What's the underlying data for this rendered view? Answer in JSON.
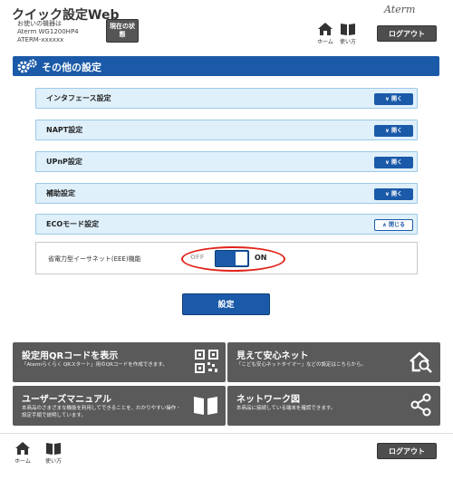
{
  "header": {
    "app_title": "クイック設定Web",
    "model_label": "お使いの機器は",
    "model_name": "Aterm WG1200HP4",
    "model_ssid": "ATERM-xxxxxx",
    "status_button": "現在の状態",
    "nav": {
      "home_label": "ホーム",
      "guide_label": "使い方"
    },
    "brand": "Aterm",
    "logout_label": "ログアウト"
  },
  "section": {
    "title": "その他の設定"
  },
  "accordion": [
    {
      "label": "インタフェース設定",
      "button": "開く",
      "expanded": false
    },
    {
      "label": "NAPT設定",
      "button": "開く",
      "expanded": false
    },
    {
      "label": "UPnP設定",
      "button": "開く",
      "expanded": false
    },
    {
      "label": "補助設定",
      "button": "開く",
      "expanded": false
    },
    {
      "label": "ECOモード設定",
      "button": "閉じる",
      "expanded": true
    }
  ],
  "eco": {
    "setting_label": "省電力型イーサネット(EEE)機能",
    "toggle_off": "OFF",
    "toggle_on": "ON",
    "state": "ON"
  },
  "submit_label": "設定",
  "tiles": [
    {
      "title": "設定用QRコードを表示",
      "desc": "「Atermらくらく QRスタート」用のQRコードを作成できます。",
      "icon": "qr-code-icon"
    },
    {
      "title": "見えて安心ネット",
      "desc": "「こども安心ネットタイマー」などの設定はこちらから。",
      "icon": "home-search-icon"
    },
    {
      "title": "ユーザーズマニュアル",
      "desc": "本商品のさまざまな機能を利用してできることを、わかりやすい操作・設定手順で説明しています。",
      "icon": "book-icon"
    },
    {
      "title": "ネットワーク図",
      "desc": "本商品に接続している端末を確認できます。",
      "icon": "share-network-icon"
    }
  ],
  "footer": {
    "home_label": "ホーム",
    "guide_label": "使い方",
    "logout_label": "ログアウト"
  },
  "colors": {
    "primary": "#1b5aa8",
    "row_bg": "#dff0fb",
    "tile_bg": "#5a5a5a",
    "highlight": "#e2231a"
  }
}
